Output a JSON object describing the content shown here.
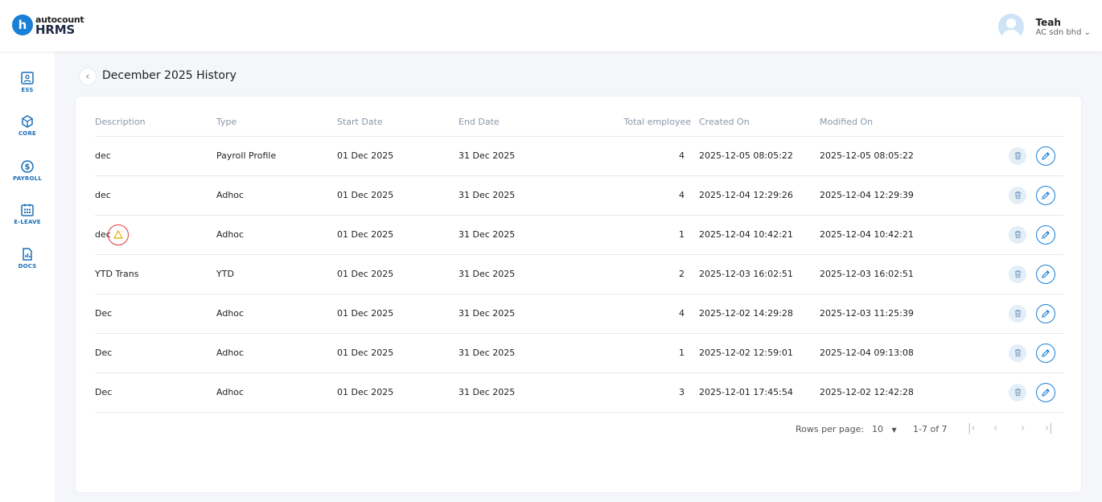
{
  "app": {
    "logo_letter": "h",
    "brand_small": "autocount",
    "brand_big": "HRMS"
  },
  "user": {
    "name": "Teah",
    "company": "AC sdn bhd",
    "chevron": "⌄"
  },
  "sidebar": {
    "items": [
      {
        "label": "ESS",
        "icon": "id-card-icon"
      },
      {
        "label": "CORE",
        "icon": "cube-icon"
      },
      {
        "label": "PAYROLL",
        "icon": "dollar-circle-icon"
      },
      {
        "label": "E-LEAVE",
        "icon": "calendar-icon"
      },
      {
        "label": "DOCS",
        "icon": "document-chart-icon"
      }
    ]
  },
  "page": {
    "title": "December 2025 History",
    "back_icon": "chevron-left-icon"
  },
  "table": {
    "columns": [
      "Description",
      "Type",
      "Start Date",
      "End Date",
      "Total employee",
      "Created On",
      "Modified On"
    ],
    "rows": [
      {
        "description": "dec",
        "type": "Payroll Profile",
        "start": "01 Dec 2025",
        "end": "31 Dec 2025",
        "total": "4",
        "created": "2025-12-05 08:05:22",
        "modified": "2025-12-05 08:05:22",
        "warning": false
      },
      {
        "description": "dec",
        "type": "Adhoc",
        "start": "01 Dec 2025",
        "end": "31 Dec 2025",
        "total": "4",
        "created": "2025-12-04 12:29:26",
        "modified": "2025-12-04 12:29:39",
        "warning": false
      },
      {
        "description": "dec",
        "type": "Adhoc",
        "start": "01 Dec 2025",
        "end": "31 Dec 2025",
        "total": "1",
        "created": "2025-12-04 10:42:21",
        "modified": "2025-12-04 10:42:21",
        "warning": true
      },
      {
        "description": "YTD Trans",
        "type": "YTD",
        "start": "01 Dec 2025",
        "end": "31 Dec 2025",
        "total": "2",
        "created": "2025-12-03 16:02:51",
        "modified": "2025-12-03 16:02:51",
        "warning": false
      },
      {
        "description": "Dec",
        "type": "Adhoc",
        "start": "01 Dec 2025",
        "end": "31 Dec 2025",
        "total": "4",
        "created": "2025-12-02 14:29:28",
        "modified": "2025-12-03 11:25:39",
        "warning": false
      },
      {
        "description": "Dec",
        "type": "Adhoc",
        "start": "01 Dec 2025",
        "end": "31 Dec 2025",
        "total": "1",
        "created": "2025-12-02 12:59:01",
        "modified": "2025-12-04 09:13:08",
        "warning": false
      },
      {
        "description": "Dec",
        "type": "Adhoc",
        "start": "01 Dec 2025",
        "end": "31 Dec 2025",
        "total": "3",
        "created": "2025-12-01 17:45:54",
        "modified": "2025-12-02 12:42:28",
        "warning": false
      }
    ]
  },
  "pagination": {
    "rows_per_page_label": "Rows per page:",
    "rows_per_page": "10",
    "range": "1-7 of 7"
  },
  "colors": {
    "accent": "#1a7fd6",
    "warning": "#f0a500",
    "highlight_ring": "#e03a3a"
  }
}
